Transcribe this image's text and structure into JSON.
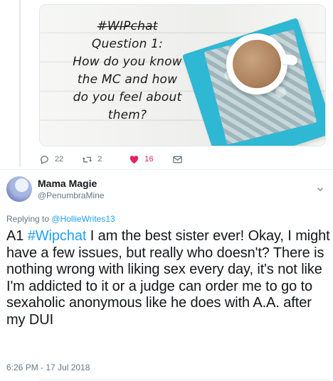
{
  "previous_tweet": {
    "media": {
      "lines": [
        "#WIPchat",
        "Question 1:",
        "How do you know",
        "the MC and how",
        "do you feel about",
        "them?"
      ]
    },
    "actions": {
      "reply_icon": "reply-icon",
      "reply_count": "22",
      "retweet_icon": "retweet-icon",
      "retweet_count": "2",
      "like_icon": "heart-icon",
      "like_count": "16",
      "dm_icon": "envelope-icon"
    }
  },
  "tweet": {
    "author_name": "Mama Magie",
    "author_handle": "@PenumbraMine",
    "replying_label": "Replying to ",
    "replying_to": "@HollieWrites13",
    "text_prefix": "A1 ",
    "hashtag": "#Wipchat",
    "text_body": " I am the best sister ever! Okay, I might have a few issues, but really who doesn't? There is nothing wrong with liking sex every day, it's not like I'm addicted to it or a judge can order me to go to sexaholic anonymous like he does with A.A. after my DUI",
    "timestamp": "6:26 PM - 17 Jul 2018"
  },
  "colors": {
    "link": "#1da1f2",
    "like": "#e0245e",
    "muted": "#657786",
    "text": "#14171a"
  }
}
